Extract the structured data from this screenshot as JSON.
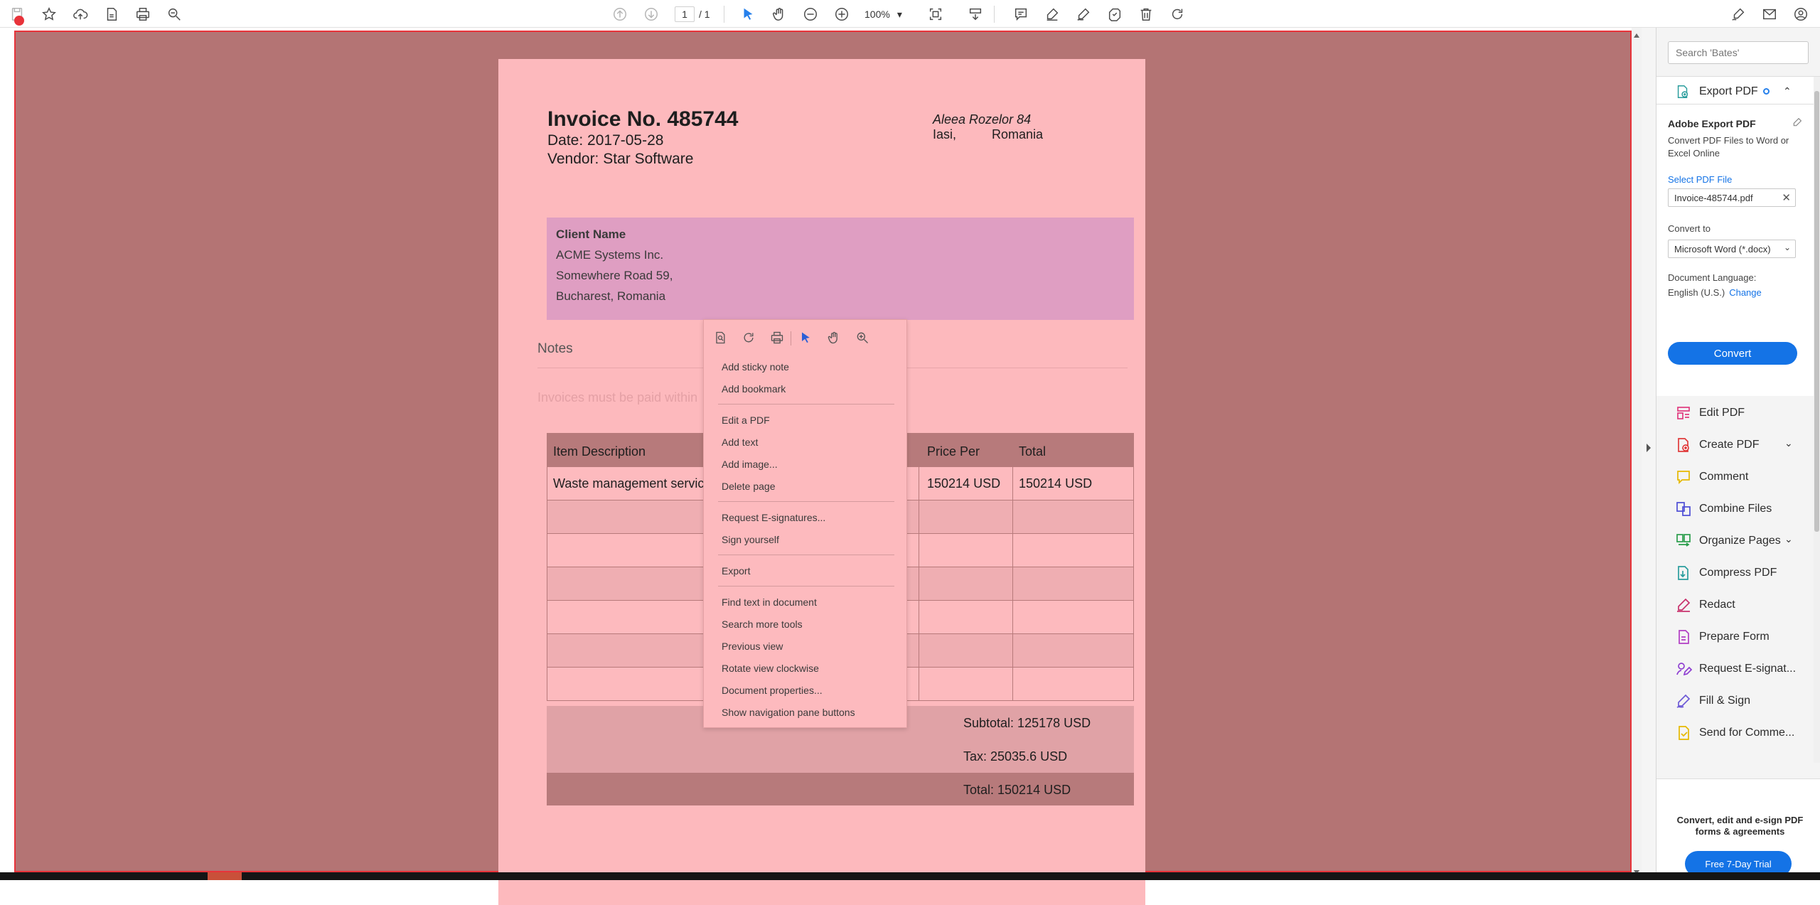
{
  "toolbar": {
    "page_current": "1",
    "page_total": "/ 1",
    "zoom": "100%",
    "icons_left": [
      "save-icon",
      "star-icon",
      "cloud-upload-icon",
      "file-icon",
      "print-icon",
      "zoom-search-icon"
    ],
    "icons_center": [
      "prev-page-icon",
      "next-page-icon",
      "select-cursor-icon",
      "hand-icon",
      "zoom-out-icon",
      "zoom-in-icon",
      "fit-page-icon",
      "scroll-mode-icon",
      "comment-icon",
      "highlight-icon",
      "sign-icon",
      "stamp-icon",
      "delete-icon",
      "rotate-icon"
    ],
    "icons_right": [
      "edit-sign-icon",
      "mail-icon",
      "account-icon"
    ]
  },
  "invoice": {
    "title": "Invoice No. 485744",
    "date": "Date: 2017-05-28",
    "vendor": "Vendor: Star Software",
    "address_line1": "Aleea Rozelor 84",
    "address_city": "Iasi,",
    "address_country": "Romania",
    "client_label": "Client Name",
    "client_company": "ACME Systems Inc.",
    "client_street": "Somewhere Road 59,",
    "client_city": "Bucharest, Romania",
    "notes_label": "Notes",
    "notes_text": "Invoices must be paid within",
    "table_headers": [
      "Item Description",
      "Price Per",
      "Total"
    ],
    "item_description": "Waste management servic",
    "item_price": "150214 USD",
    "item_total": "150214 USD",
    "subtotal": "Subtotal: 125178 USD",
    "tax": "Tax: 25035.6 USD",
    "total": "Total: 150214 USD"
  },
  "context_menu": {
    "icons": [
      "page-icon",
      "rotate-icon",
      "print-icon",
      "select-cursor-icon",
      "hand-icon",
      "zoom-in-icon"
    ],
    "items": [
      "Add sticky note",
      "Add bookmark",
      "Edit a PDF",
      "Add text",
      "Add image...",
      "Delete page",
      "Request E-signatures...",
      "Sign yourself",
      "Export",
      "Find text in document",
      "Search more tools",
      "Previous view",
      "Rotate view clockwise",
      "Document properties...",
      "Show navigation pane buttons"
    ]
  },
  "right_pane": {
    "search_placeholder": "Search 'Bates'",
    "export_header": "Export PDF",
    "panel_title": "Adobe Export PDF",
    "panel_desc": "Convert PDF Files to Word or Excel Online",
    "select_link": "Select PDF File",
    "file_name": "Invoice-485744.pdf",
    "convert_to_label": "Convert to",
    "convert_to_value": "Microsoft Word (*.docx)",
    "doc_lang_label": "Document Language:",
    "doc_lang_value": "English (U.S.)",
    "change_link": "Change",
    "convert_button": "Convert",
    "tools": [
      {
        "label": "Edit PDF",
        "icon": "edit-pdf-icon",
        "color": "#e03a7e"
      },
      {
        "label": "Create PDF",
        "icon": "create-pdf-icon",
        "color": "#e03a3a"
      },
      {
        "label": "Comment",
        "icon": "comment-icon",
        "color": "#e6b800"
      },
      {
        "label": "Combine Files",
        "icon": "combine-files-icon",
        "color": "#4d4dd6"
      },
      {
        "label": "Organize Pages",
        "icon": "organize-pages-icon",
        "color": "#2a9d4b"
      },
      {
        "label": "Compress PDF",
        "icon": "compress-pdf-icon",
        "color": "#2a9d9d"
      },
      {
        "label": "Redact",
        "icon": "redact-icon",
        "color": "#c8336d"
      },
      {
        "label": "Prepare Form",
        "icon": "prepare-form-icon",
        "color": "#b23ec4"
      },
      {
        "label": "Request E-signat...",
        "icon": "request-esign-icon",
        "color": "#8e3fd1"
      },
      {
        "label": "Fill & Sign",
        "icon": "fill-sign-icon",
        "color": "#6e5bd6"
      },
      {
        "label": "Send for Comme...",
        "icon": "send-comment-icon",
        "color": "#e6b800"
      }
    ],
    "promo_text": "Convert, edit and e-sign PDF forms & agreements",
    "trial_button": "Free 7-Day Trial"
  }
}
